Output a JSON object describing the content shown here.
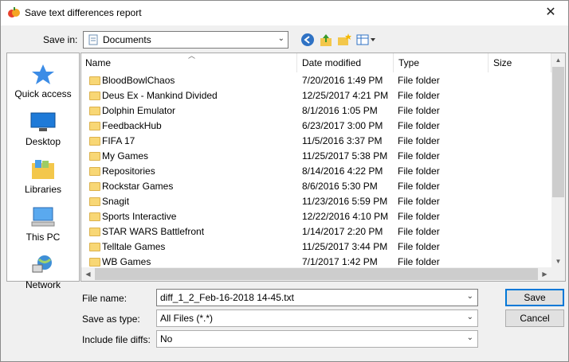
{
  "title": "Save text differences report",
  "save_in": {
    "label": "Save in:",
    "value": "Documents"
  },
  "places": [
    {
      "label": "Quick access",
      "icon": "star-icon"
    },
    {
      "label": "Desktop",
      "icon": "desktop-icon"
    },
    {
      "label": "Libraries",
      "icon": "libraries-icon"
    },
    {
      "label": "This PC",
      "icon": "computer-icon"
    },
    {
      "label": "Network",
      "icon": "network-icon"
    }
  ],
  "columns": [
    "Name",
    "Date modified",
    "Type",
    "Size"
  ],
  "files": [
    {
      "name": "BloodBowlChaos",
      "date": "7/20/2016 1:49 PM",
      "type": "File folder"
    },
    {
      "name": "Deus Ex -  Mankind Divided",
      "date": "12/25/2017 4:21 PM",
      "type": "File folder"
    },
    {
      "name": "Dolphin Emulator",
      "date": "8/1/2016 1:05 PM",
      "type": "File folder"
    },
    {
      "name": "FeedbackHub",
      "date": "6/23/2017 3:00 PM",
      "type": "File folder"
    },
    {
      "name": "FIFA 17",
      "date": "11/5/2016 3:37 PM",
      "type": "File folder"
    },
    {
      "name": "My Games",
      "date": "11/25/2017 5:38 PM",
      "type": "File folder"
    },
    {
      "name": "Repositories",
      "date": "8/14/2016 4:22 PM",
      "type": "File folder"
    },
    {
      "name": "Rockstar Games",
      "date": "8/6/2016 5:30 PM",
      "type": "File folder"
    },
    {
      "name": "Snagit",
      "date": "11/23/2016 5:59 PM",
      "type": "File folder"
    },
    {
      "name": "Sports Interactive",
      "date": "12/22/2016 4:10 PM",
      "type": "File folder"
    },
    {
      "name": "STAR WARS Battlefront",
      "date": "1/14/2017 2:20 PM",
      "type": "File folder"
    },
    {
      "name": "Telltale Games",
      "date": "11/25/2017 3:44 PM",
      "type": "File folder"
    },
    {
      "name": "WB Games",
      "date": "7/1/2017 1:42 PM",
      "type": "File folder"
    }
  ],
  "form": {
    "filename_label": "File name:",
    "filename_value": "diff_1_2_Feb-16-2018 14-45.txt",
    "type_label": "Save as type:",
    "type_value": "All Files (*.*)",
    "include_label": "Include file diffs:",
    "include_value": "No"
  },
  "buttons": {
    "save": "Save",
    "cancel": "Cancel"
  },
  "colors": {
    "folder": "#f8d775",
    "accent": "#0078d7"
  }
}
